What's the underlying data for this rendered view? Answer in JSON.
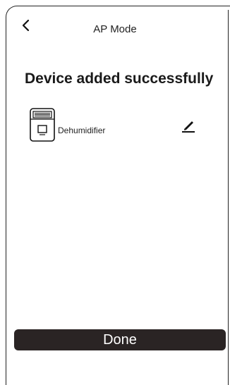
{
  "header": {
    "title": "AP Mode",
    "back_icon": "chevron-left-icon"
  },
  "main": {
    "headline": "Device added successfully",
    "device": {
      "name": "Dehumidifier",
      "icon": "dehumidifier-icon",
      "edit_icon": "pencil-icon"
    }
  },
  "footer": {
    "done_label": "Done"
  },
  "colors": {
    "button_bg": "#2a2424",
    "button_text": "#ffffff",
    "text": "#1a1a1a",
    "background": "#ffffff"
  }
}
